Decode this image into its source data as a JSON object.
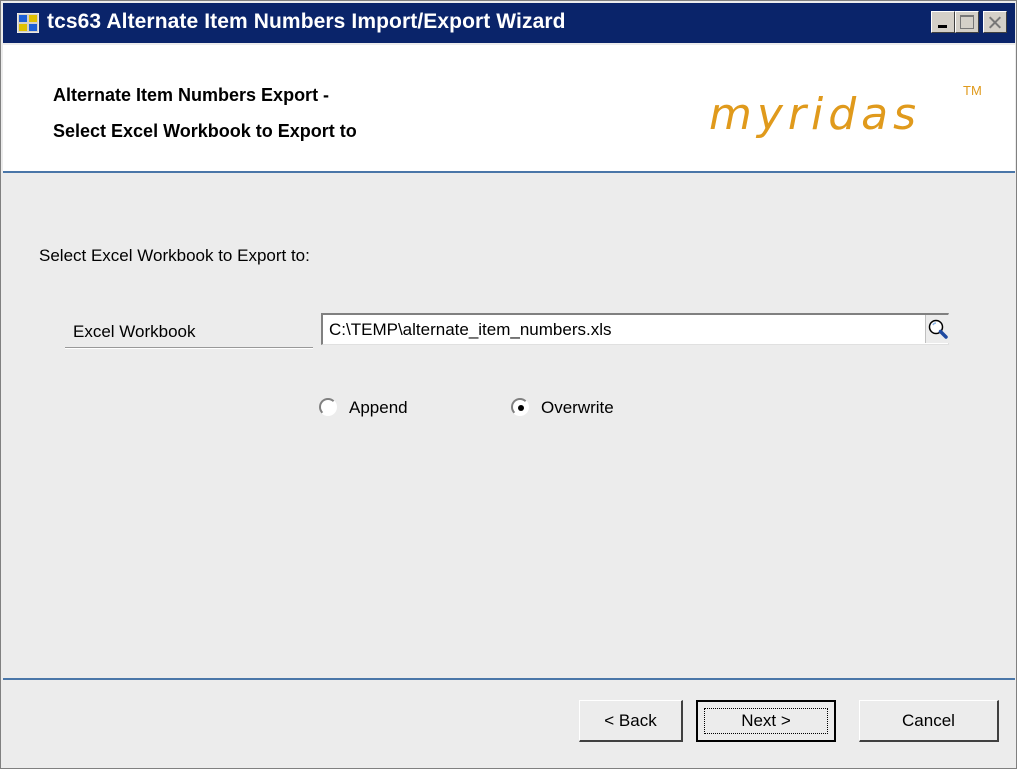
{
  "window": {
    "title": "tcs63 Alternate Item Numbers Import/Export Wizard"
  },
  "header": {
    "line1": "Alternate Item Numbers Export -",
    "line2": "Select Excel Workbook to Export to",
    "brand": "myridas",
    "brand_tm": "TM"
  },
  "form": {
    "section_label": "Select Excel Workbook to Export to:",
    "workbook_label": "Excel Workbook",
    "workbook_value": "C:\\TEMP\\alternate_item_numbers.xls",
    "browse_icon": "magnifier-icon"
  },
  "mode": {
    "options": [
      {
        "label": "Append",
        "selected": false
      },
      {
        "label": "Overwrite",
        "selected": true
      }
    ]
  },
  "buttons": {
    "back": "< Back",
    "next": "Next >",
    "cancel": "Cancel"
  },
  "colors": {
    "titlebar": "#0a246a",
    "brand": "#e09a1c",
    "accent_line": "#4a76a8"
  }
}
